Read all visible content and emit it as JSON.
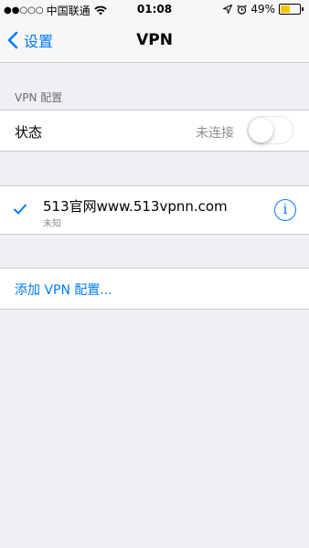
{
  "status_bar": {
    "signal": "●●○○○",
    "carrier": "中国联通",
    "wifi_icon": "wifi-icon",
    "time": "01:08",
    "battery_percent": "49%",
    "battery_level": 0.49,
    "battery_color": "#f5c400"
  },
  "nav": {
    "back_label": "设置",
    "title": "VPN"
  },
  "section": {
    "header": "VPN 配置"
  },
  "status_row": {
    "label": "状态",
    "value": "未连接",
    "toggle_on": false
  },
  "vpn_config": {
    "name": "513官网www.513vpnn.com",
    "subtitle": "未知",
    "selected": true,
    "info_glyph": "i"
  },
  "add_config": {
    "label": "添加 VPN 配置..."
  },
  "colors": {
    "accent": "#007aff",
    "background": "#efeff4"
  }
}
